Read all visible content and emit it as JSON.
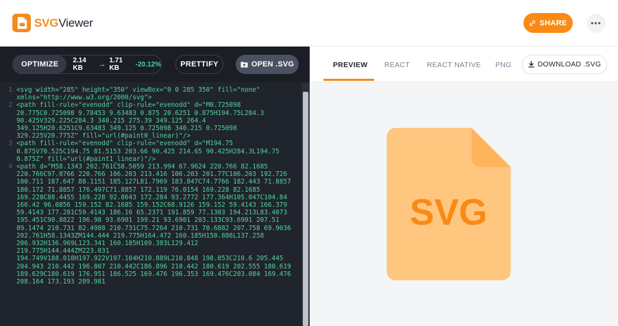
{
  "header": {
    "logo_prefix": "SVG",
    "logo_suffix": "Viewer",
    "share_label": "SHARE",
    "more_label": "•••"
  },
  "toolbar": {
    "optimize_label": "OPTIMIZE",
    "original_size": "2.14 KB",
    "arrow": "→",
    "optimized_size": "1.71 KB",
    "reduction": "-20.12%",
    "prettify_label": "PRETTIFY",
    "open_label": "OPEN .SVG"
  },
  "code_lines": [
    {
      "n": "1",
      "text": "<svg width=\"285\" height=\"350\" viewBox=\"0 0 285 350\" fill=\"none\" xmlns=\"http://www.w3.org/2000/svg\">"
    },
    {
      "n": "2",
      "text": "<path fill-rule=\"evenodd\" clip-rule=\"evenodd\" d=\"M0.725098 20.775C0.725098 9.78453 9.63483 0.875 20.6251 0.875H194.75L284.3 90.425V329.225C284.3 340.215 275.39 349.125 264.4 349.125H20.6251C9.63483 349.125 0.725098 340.215 0.725098 329.225V20.775Z\" fill=\"url(#paint0_linear)\"/>"
    },
    {
      "n": "3",
      "text": "<path fill-rule=\"evenodd\" clip-rule=\"evenodd\" d=\"M194.75 0.875V70.525C194.75 81.5153 203.66 90.425 214.65 90.425H284.3L194.75 0.875Z\" fill=\"url(#paint1_linear)\"/>"
    },
    {
      "n": "4",
      "text": "<path d=\"M58.1343 202.761C58.5059 213.994 67.9624 220.766 82.1685 220.766C97.0766 220.766 106.203 213.416 106.203 201.77C106.203 192.726 100.711 187.647 88.1151 185.127L81.7969 183.847C74.7766 182.443 71.8857 180.172 71.8857 176.497C71.8857 172.119 76.0154 169.228 82.1685 169.228C88.4455 169.228 92.8643 172.284 93.2772 177.364H105.047C104.84 166.42 96.0856 159.152 82.1685 159.152C68.9126 159.152 59.4143 166.379 59.4143 177.281C59.4143 186.16 65.2371 191.859 77.1303 194.213L83.4073 195.451C90.8822 196.98 93.6901 199.21 93.6901 203.133C93.6901 207.51 89.1474 210.731 82.4988 210.731C75.7264 210.731 70.6882 207.758 69.9036 202.761H58.1343ZM144.444 219.775H164.472 160.185H150.886L137.258 206.932H136.969L123.341 160.185H109.383L129.412 219.775H144.444ZM223.031 194.749V188.018H197.922V197.104H210.889L210.848 198.053C210.6 205.445 204.943 210.442 196.807 210.442C186.896 210.442 180.619 202.555 180.619 189.629C180.619 176.951 186.525 169.476 196.353 169.476C203.084 169.476 208.164 173.193 209.981"
    }
  ],
  "tabs": [
    {
      "label": "PREVIEW",
      "active": true
    },
    {
      "label": "REACT",
      "active": false
    },
    {
      "label": "REACT NATIVE",
      "active": false
    },
    {
      "label": "PNG",
      "active": false
    }
  ],
  "download_label": "DOWNLOAD .SVG",
  "preview": {
    "file_text": "SVG",
    "colors": {
      "accent": "#fa8a14",
      "file_body": "#ffc680",
      "file_fold": "#ffb45c",
      "file_text": "#fa8a14",
      "code_text": "#52d49c",
      "reduction": "#45d6a0"
    }
  },
  "icons": {
    "logo": "svgviewer-logo-icon",
    "share": "link-icon",
    "more": "more-dots-icon",
    "open": "folder-upload-icon",
    "download": "download-icon"
  }
}
